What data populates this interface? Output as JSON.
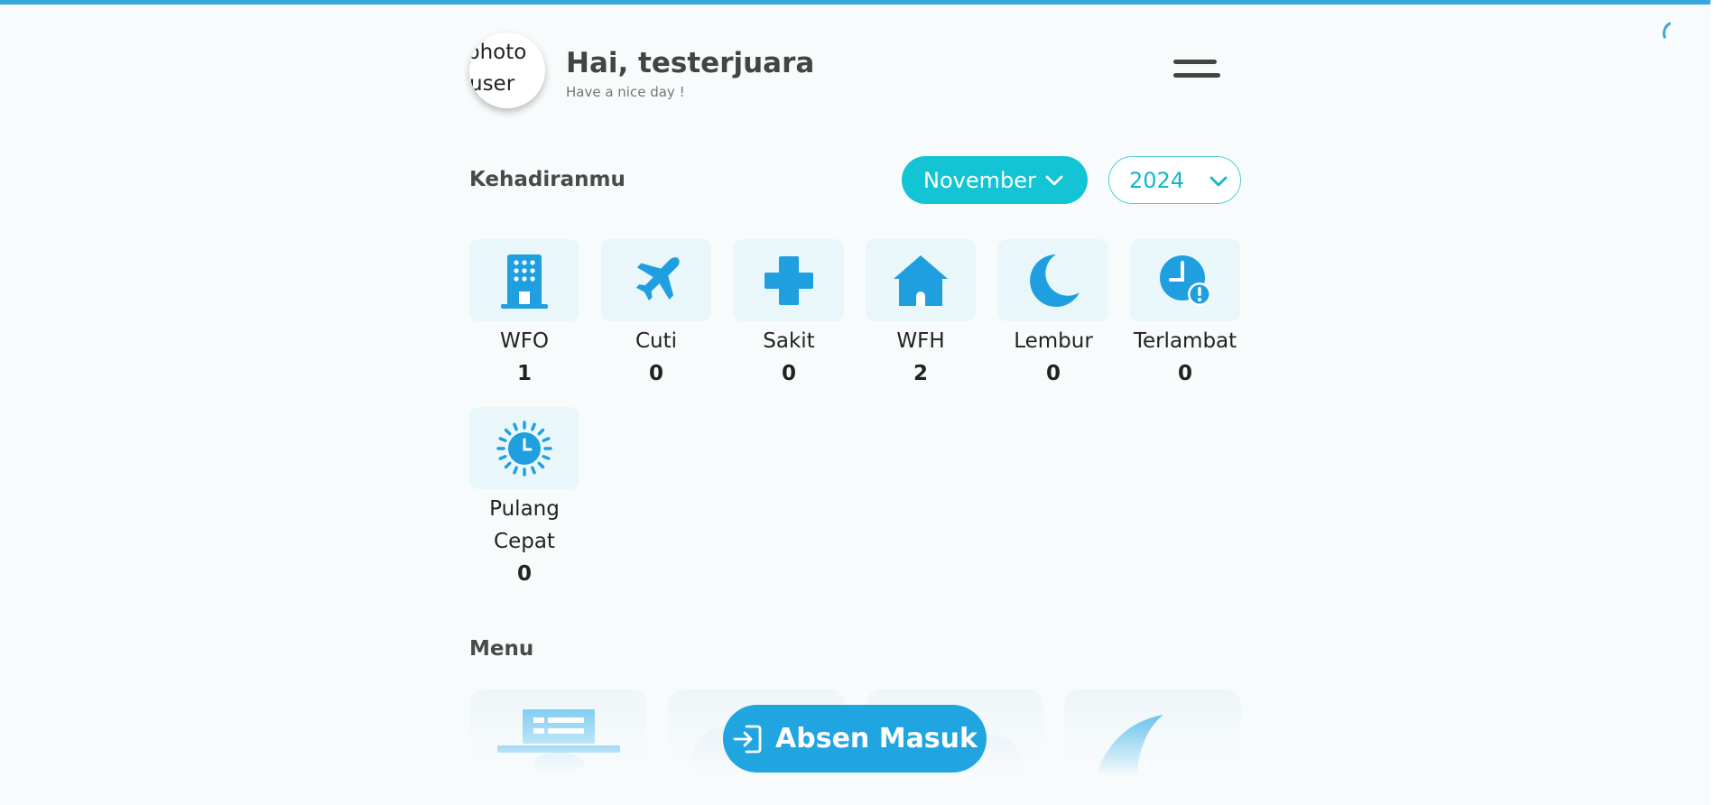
{
  "header": {
    "avatar_alt": "photo\nuser",
    "greeting": "Hai, testerjuara",
    "subtitle": "Have a nice day !"
  },
  "attendance": {
    "title": "Kehadiranmu",
    "month": "November",
    "year": "2024",
    "items": [
      {
        "icon": "building-icon",
        "label": "WFO",
        "value": "1"
      },
      {
        "icon": "airplane-icon",
        "label": "Cuti",
        "value": "0"
      },
      {
        "icon": "medical-cross-icon",
        "label": "Sakit",
        "value": "0"
      },
      {
        "icon": "house-icon",
        "label": "WFH",
        "value": "2"
      },
      {
        "icon": "moon-icon",
        "label": "Lembur",
        "value": "0"
      },
      {
        "icon": "clock-alert-icon",
        "label": "Terlambat",
        "value": "0"
      },
      {
        "icon": "sun-clock-icon",
        "label": "Pulang\nCepat",
        "value": "0"
      }
    ]
  },
  "menu": {
    "title": "Menu"
  },
  "action": {
    "label": "Absen Masuk",
    "icon": "sign-in-icon"
  },
  "colors": {
    "primary": "#21a5e0",
    "accent": "#13c4d5",
    "tile_bg": "#e9f6fa"
  }
}
